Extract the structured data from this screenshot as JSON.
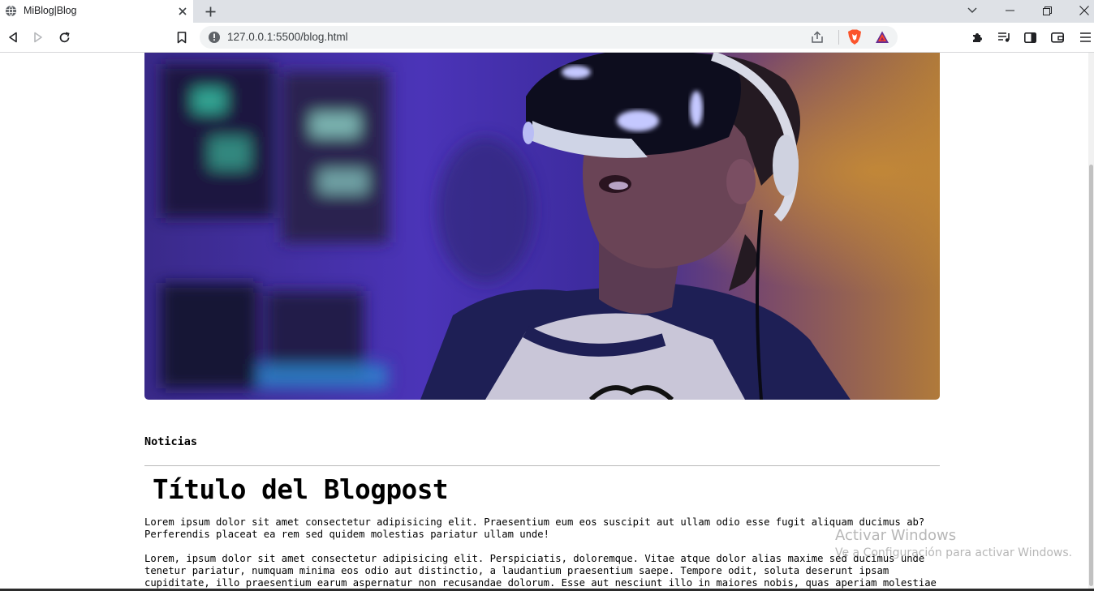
{
  "browser": {
    "tab": {
      "title": "MiBlog|Blog",
      "favicon": "globe-icon"
    },
    "url": "127.0.0.1:5500/blog.html",
    "colors": {
      "tabstrip": "#dee1e6",
      "omnibox": "#f1f3f4",
      "brave_orange": "#fb542b"
    }
  },
  "page": {
    "hero_image": {
      "subject": "vr-headset-photo"
    },
    "category": "Noticias",
    "post_title": "Título del Blogpost",
    "paragraphs": [
      "Lorem ipsum dolor sit amet consectetur adipisicing elit. Praesentium eum eos suscipit aut ullam odio esse fugit aliquam ducimus ab? Perferendis placeat ea rem sed quidem molestias pariatur ullam unde!",
      "Lorem, ipsum dolor sit amet consectetur adipisicing elit. Perspiciatis, doloremque. Vitae atque dolor alias maxime sed ducimus unde tenetur pariatur, numquam minima eos odio aut distinctio, a laudantium praesentium saepe. Tempore odit, soluta deserunt ipsam cupiditate, illo praesentium earum aspernatur non recusandae dolorum. Esse aut nesciunt illo in maiores nobis, quas aperiam molestiae blanditiis ea"
    ]
  },
  "watermark": {
    "title": "Activar Windows",
    "subtitle": "Ve a Configuración para activar Windows."
  }
}
